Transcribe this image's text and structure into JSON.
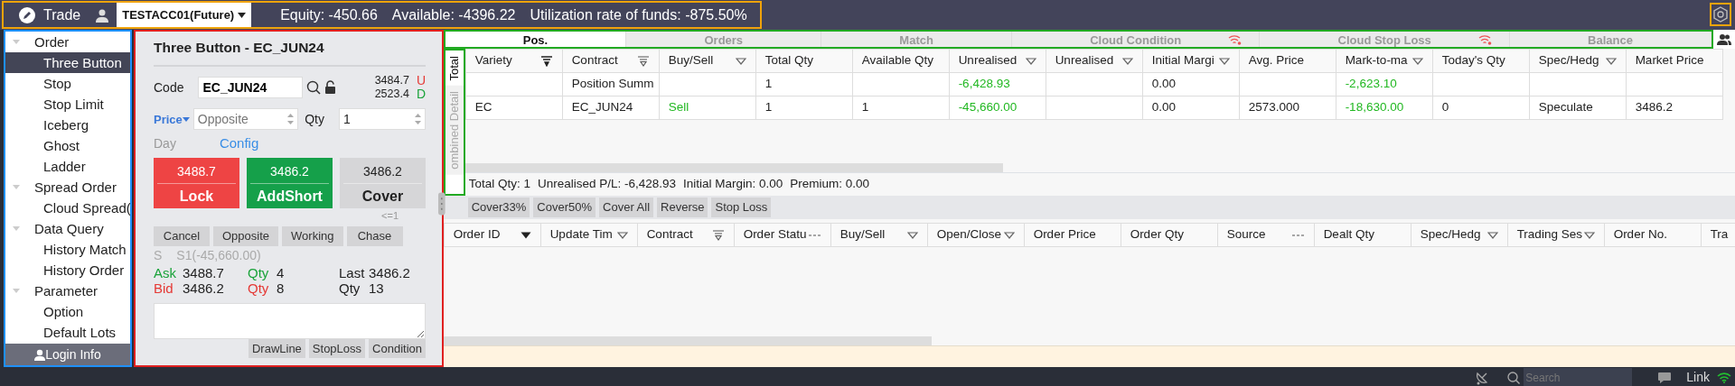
{
  "topbar": {
    "app": "Trade",
    "account": "TESTACC01(Future)",
    "stats": [
      "Equity: -450.66",
      "Available: -4396.22",
      "Utilization rate of funds: -875.50%"
    ]
  },
  "sidebar": {
    "items": [
      {
        "label": "Order",
        "expanded": true,
        "selected": false,
        "children": [
          {
            "label": "Three Button",
            "selected": true
          },
          {
            "label": "Stop",
            "selected": false
          },
          {
            "label": "Stop Limit",
            "selected": false
          },
          {
            "label": "Iceberg",
            "selected": false
          },
          {
            "label": "Ghost",
            "selected": false
          },
          {
            "label": "Ladder",
            "selected": false
          }
        ]
      },
      {
        "label": "Spread Order",
        "expanded": true,
        "selected": false,
        "children": [
          {
            "label": "Cloud Spread(",
            "selected": false
          }
        ]
      },
      {
        "label": "Data Query",
        "expanded": true,
        "selected": false,
        "children": [
          {
            "label": "History Match",
            "selected": false
          },
          {
            "label": "History Order",
            "selected": false
          }
        ]
      },
      {
        "label": "Parameter",
        "expanded": true,
        "selected": false,
        "children": [
          {
            "label": "Option",
            "selected": false
          },
          {
            "label": "Default Lots",
            "selected": false
          }
        ]
      }
    ],
    "footer": "Login Info"
  },
  "order_panel": {
    "title": "Three Button - EC_JUN24",
    "code_label": "Code",
    "code": "EC_JUN24",
    "limits": [
      {
        "value": "3484.7",
        "flag": "U",
        "color": "#e53935"
      },
      {
        "value": "2523.4",
        "flag": "D",
        "color": "#1aa33a"
      }
    ],
    "price_label": "Price",
    "price_type": "Opposite",
    "qty_label": "Qty",
    "qty": "1",
    "tif": "Day",
    "config": "Config",
    "big_buttons": [
      {
        "price": "3488.7",
        "label": "Lock",
        "color": "#ee4444"
      },
      {
        "price": "3486.2",
        "label": "AddShort",
        "color": "#15a04a"
      },
      {
        "price": "3486.2",
        "label": "Cover",
        "color": "#d6d6d8"
      }
    ],
    "cover_note": "<=1",
    "small_buttons": [
      "Cancel",
      "Opposite",
      "Working",
      "Chase"
    ],
    "position_line": [
      "S",
      "S1(-45,660.00)"
    ],
    "quote": [
      {
        "side": "Ask",
        "price": "3488.7",
        "qty_label": "Qty",
        "qty": "4",
        "color": "#1aa33a",
        "extra_label": "Last",
        "extra": "3486.2"
      },
      {
        "side": "Bid",
        "price": "3486.2",
        "qty_label": "Qty",
        "qty": "8",
        "color": "#e53935",
        "extra_label": "Qty",
        "extra": "13"
      }
    ],
    "tools": [
      "DrawLine",
      "StopLoss",
      "Condition"
    ]
  },
  "tabs": [
    {
      "label": "Pos.",
      "selected": true,
      "offline": false
    },
    {
      "label": "Orders",
      "selected": false,
      "offline": false
    },
    {
      "label": "Match",
      "selected": false,
      "offline": false
    },
    {
      "label": "Cloud Condition",
      "selected": false,
      "offline": true
    },
    {
      "label": "Cloud Stop Loss",
      "selected": false,
      "offline": true
    },
    {
      "label": "Balance",
      "selected": false,
      "offline": false
    }
  ],
  "side_tabs": [
    {
      "label": "Total",
      "selected": true
    },
    {
      "label": "ombined Detail",
      "selected": false
    }
  ],
  "positions": {
    "columns": [
      {
        "label": "Variety",
        "kind": "filter-on"
      },
      {
        "label": "Contract",
        "kind": "filter"
      },
      {
        "label": "Buy/Sell",
        "kind": "menu"
      },
      {
        "label": "Total Qty",
        "kind": "plain"
      },
      {
        "label": "Available Qty",
        "kind": "plain"
      },
      {
        "label": "Unrealised",
        "kind": "menu"
      },
      {
        "label": "Unrealised",
        "kind": "menu"
      },
      {
        "label": "Initial Margi",
        "kind": "menu"
      },
      {
        "label": "Avg. Price",
        "kind": "plain"
      },
      {
        "label": "Mark-to-ma",
        "kind": "menu"
      },
      {
        "label": "Today's Qty",
        "kind": "plain"
      },
      {
        "label": "Spec/Hedg",
        "kind": "menu"
      },
      {
        "label": "Market Price",
        "kind": "plain"
      }
    ],
    "rows": [
      [
        null,
        "Position Summ",
        null,
        "1",
        null,
        {
          "text": "-6,428.93",
          "color": "#22b822"
        },
        null,
        "0.00",
        null,
        {
          "text": "-2,623.10",
          "color": "#22b822"
        },
        null,
        null,
        null
      ],
      [
        "EC",
        "EC_JUN24",
        {
          "text": "Sell",
          "color": "#22b822"
        },
        "1",
        "1",
        {
          "text": "-45,660.00",
          "color": "#22b822"
        },
        null,
        "0.00",
        "2573.000",
        {
          "text": "-18,630.00",
          "color": "#22b822"
        },
        "0",
        "Speculate",
        "3486.2"
      ]
    ],
    "summary": [
      "Total Qty: 1",
      "Unrealised P/L: -6,428.93",
      "Initial Margin: 0.00",
      "Premium: 0.00"
    ]
  },
  "actions": [
    "Cover33%",
    "Cover50%",
    "Cover All",
    "Reverse",
    "Stop Loss"
  ],
  "orders": {
    "columns": [
      {
        "label": "Order ID",
        "kind": "sort"
      },
      {
        "label": "Update Tim",
        "kind": "menu"
      },
      {
        "label": "Contract",
        "kind": "filter"
      },
      {
        "label": "Order Statu",
        "kind": "dash"
      },
      {
        "label": "Buy/Sell",
        "kind": "menu"
      },
      {
        "label": "Open/Close",
        "kind": "menu"
      },
      {
        "label": "Order Price",
        "kind": "plain"
      },
      {
        "label": "Order Qty",
        "kind": "plain"
      },
      {
        "label": "Source",
        "kind": "dash"
      },
      {
        "label": "Dealt Qty",
        "kind": "plain"
      },
      {
        "label": "Spec/Hedg",
        "kind": "menu"
      },
      {
        "label": "Trading Ses",
        "kind": "menu"
      },
      {
        "label": "Order No.",
        "kind": "plain"
      },
      {
        "label": "Tra",
        "kind": "plain"
      }
    ]
  },
  "status_bar": {
    "search": {
      "placeholder": "Search"
    },
    "link": "Link"
  }
}
